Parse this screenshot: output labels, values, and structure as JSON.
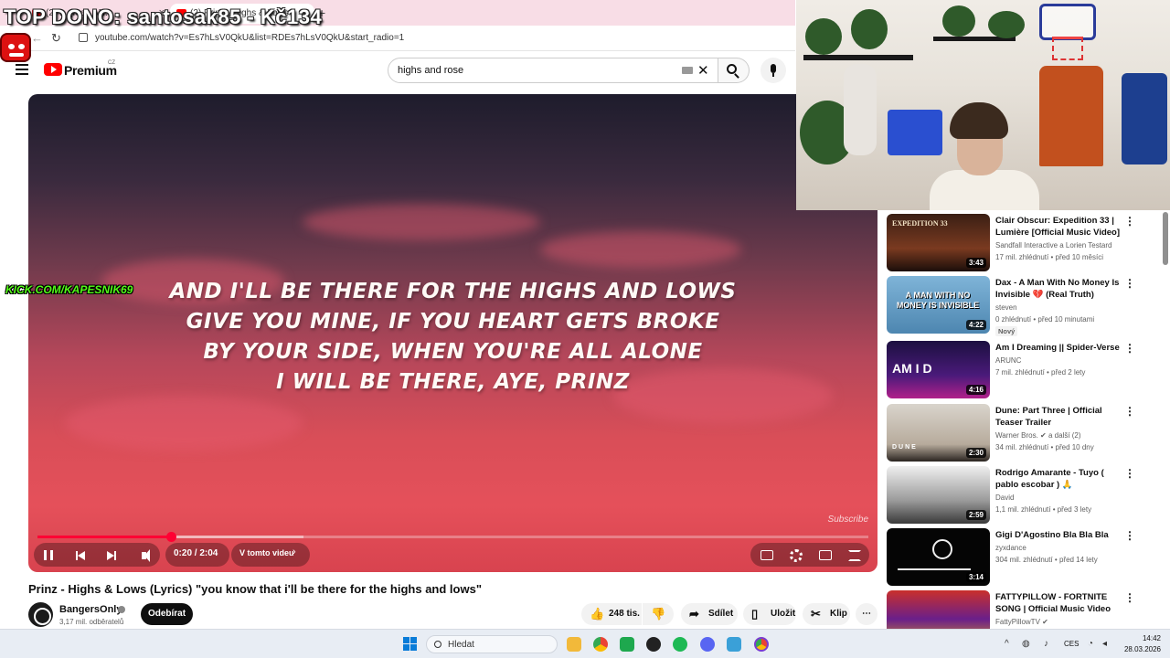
{
  "browser": {
    "tab1_title": "(2) ... (feat. AN...",
    "tab2_title": "(2) Prinz - Highs & Lows",
    "url": "youtube.com/watch?v=Es7hLsV0QkU&list=RDEs7hLsV0QkU&start_radio=1"
  },
  "overlay": {
    "top_dono": "TOP DONO: santosak85 - Kč134",
    "kick_link": "KICK.COM/KAPESNIK69"
  },
  "youtube": {
    "logo_text": "Premium",
    "country": "CZ",
    "search_value": "highs and rose"
  },
  "player": {
    "lyrics": [
      "AND I'LL BE THERE FOR THE HIGHS AND LOWS",
      "GIVE YOU MINE, IF YOU HEART GETS BROKE",
      "BY YOUR SIDE, WHEN YOU'RE ALL ALONE",
      "I WILL BE THERE, AYE, PRINZ"
    ],
    "watermark": "Subscribe",
    "time_display": "0:20 / 2:04",
    "chapter_label": "V tomto videu",
    "progress_fraction": 0.161,
    "buffer_fraction": 0.32,
    "accent_color": "#ff0033"
  },
  "video": {
    "title": "Prinz - Highs & Lows (Lyrics) \"you know that i'll be there for the highs and lows\"",
    "channel_name": "BangersOnly",
    "subscribers": "3,17 mil. odběratelů",
    "subscribe_label": "Odebírat",
    "likes": "248 tis.",
    "share_label": "Sdílet",
    "save_label": "Uložit",
    "clip_label": "Klip"
  },
  "recommendations": [
    {
      "title": "Clair Obscur: Expedition 33 | Lumière [Official Music Video]",
      "channel": "Sandfall Interactive a Lorien Testard",
      "meta": "17 mil. zhlédnutí • před 10 měsíci",
      "duration": "3:43",
      "thumb_text": "EXPEDITION 33",
      "badge": ""
    },
    {
      "title": "Dax - A Man With No Money Is Invisible 💔 (Real Truth)",
      "channel": "steven",
      "meta": "0 zhlédnutí • před 10 minutami",
      "duration": "4:22",
      "thumb_text": "A MAN WITH NO MONEY IS INVISIBLE",
      "badge": "Nový"
    },
    {
      "title": "Am I Dreaming || Spider-Verse",
      "channel": "ARUNC",
      "meta": "7 mil. zhlédnutí • před 2 lety",
      "duration": "4:16",
      "thumb_text": "AM I D",
      "badge": ""
    },
    {
      "title": "Dune: Part Three | Official Teaser Trailer",
      "channel": "Warner Bros. ✔ a další (2)",
      "meta": "34 mil. zhlédnutí • před 10 dny",
      "duration": "2:30",
      "thumb_text": "DUNE",
      "badge": ""
    },
    {
      "title": "Rodrigo Amarante - Tuyo ( pablo escobar ) 🙏",
      "channel": "David",
      "meta": "1,1 mil. zhlédnutí • před 3 lety",
      "duration": "2:59",
      "thumb_text": "",
      "badge": ""
    },
    {
      "title": "Gigi D'Agostino Bla Bla Bla",
      "channel": "zyxdance",
      "meta": "304 mil. zhlédnutí • před 14 lety",
      "duration": "3:14",
      "thumb_text": "",
      "badge": ""
    },
    {
      "title": "FATTYPILLOW - FORTNITE SONG | Official Music Video",
      "channel": "FattyPillowTV ✔",
      "meta": "",
      "duration": "",
      "thumb_text": "",
      "badge": ""
    }
  ],
  "taskbar": {
    "search_label": "Hledat",
    "language": "CES",
    "time": "14:42",
    "date": "28.03.2026"
  }
}
